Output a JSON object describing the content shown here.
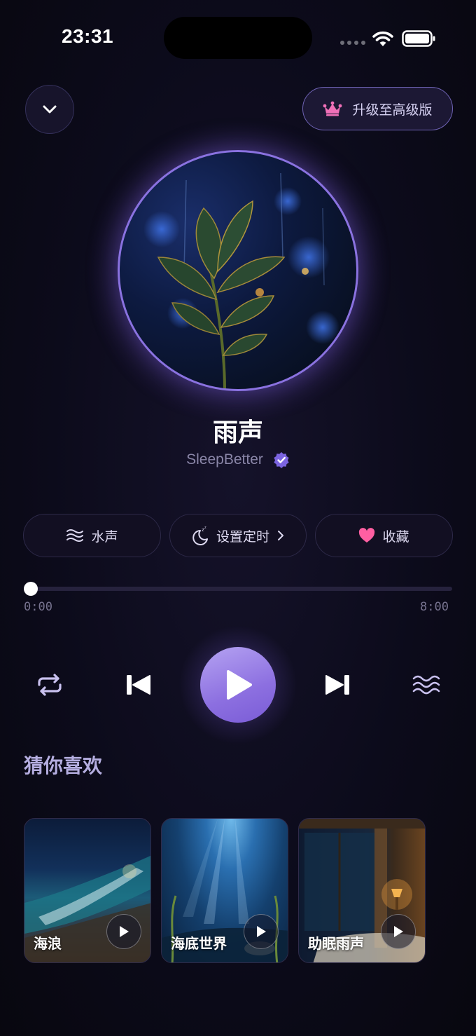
{
  "status_bar": {
    "time": "23:31"
  },
  "header": {
    "upgrade_label": "升级至高级版"
  },
  "track": {
    "title": "雨声",
    "artist": "SleepBetter"
  },
  "pills": {
    "water": "水声",
    "timer": "设置定时",
    "favorite": "收藏"
  },
  "progress": {
    "current": "0:00",
    "total": "8:00",
    "fraction": 0.0
  },
  "recommendations": {
    "title": "猜你喜欢",
    "items": [
      {
        "label": "海浪"
      },
      {
        "label": "海底世界"
      },
      {
        "label": "助眠雨声"
      }
    ]
  },
  "colors": {
    "accent": "#8c6fe0",
    "heart": "#ff5fa2",
    "crown": "#f070b8",
    "verified": "#7b64e0"
  }
}
